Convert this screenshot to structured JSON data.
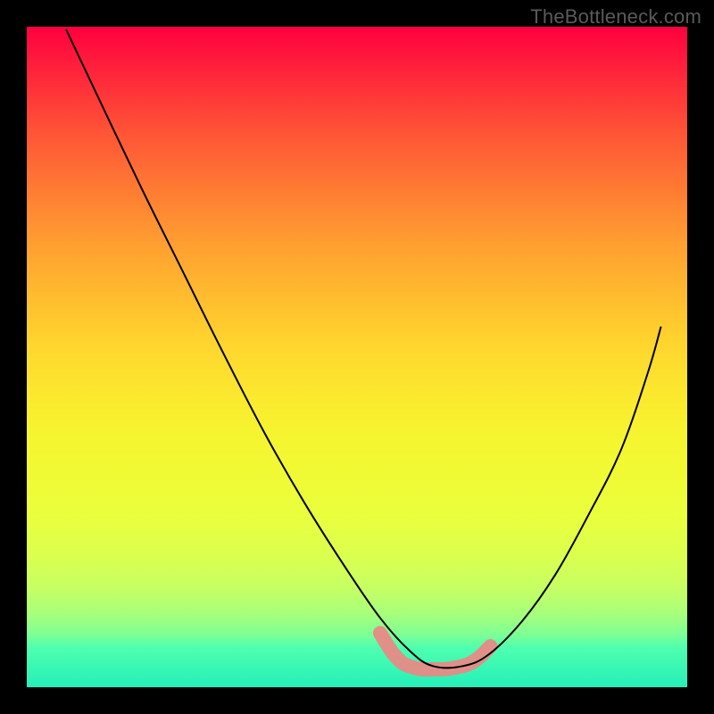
{
  "watermark": "TheBottleneck.com",
  "colors": {
    "watermark": "#5a5a5a",
    "curve": "#000000",
    "highlight": "#e88a86"
  },
  "chart_data": {
    "type": "line",
    "title": "",
    "xlabel": "",
    "ylabel": "",
    "xlim": [
      0,
      1
    ],
    "ylim": [
      0,
      1
    ],
    "notes": "No axes or tick labels are visible. Values are inferred from the curve shape as fractions of the plot area: x=0..1 left→right, y=0..1 top→bottom. Main black V-shaped curve plunges from near top-left to a trough around x≈0.62 and rises toward x≈0.95, y≈0.45. A short salmon-colored thick segment traces the trough.",
    "series": [
      {
        "name": "main-curve",
        "x": [
          0.06,
          0.112,
          0.174,
          0.236,
          0.298,
          0.36,
          0.42,
          0.48,
          0.535,
          0.58,
          0.615,
          0.66,
          0.7,
          0.75,
          0.8,
          0.85,
          0.9,
          0.94,
          0.96
        ],
        "y": [
          0.005,
          0.115,
          0.245,
          0.37,
          0.495,
          0.615,
          0.72,
          0.815,
          0.895,
          0.945,
          0.968,
          0.968,
          0.95,
          0.9,
          0.83,
          0.74,
          0.64,
          0.525,
          0.455
        ]
      },
      {
        "name": "trough-highlight",
        "x": [
          0.535,
          0.56,
          0.585,
          0.615,
          0.65,
          0.678,
          0.702
        ],
        "y": [
          0.918,
          0.955,
          0.97,
          0.973,
          0.97,
          0.96,
          0.938
        ]
      }
    ]
  }
}
